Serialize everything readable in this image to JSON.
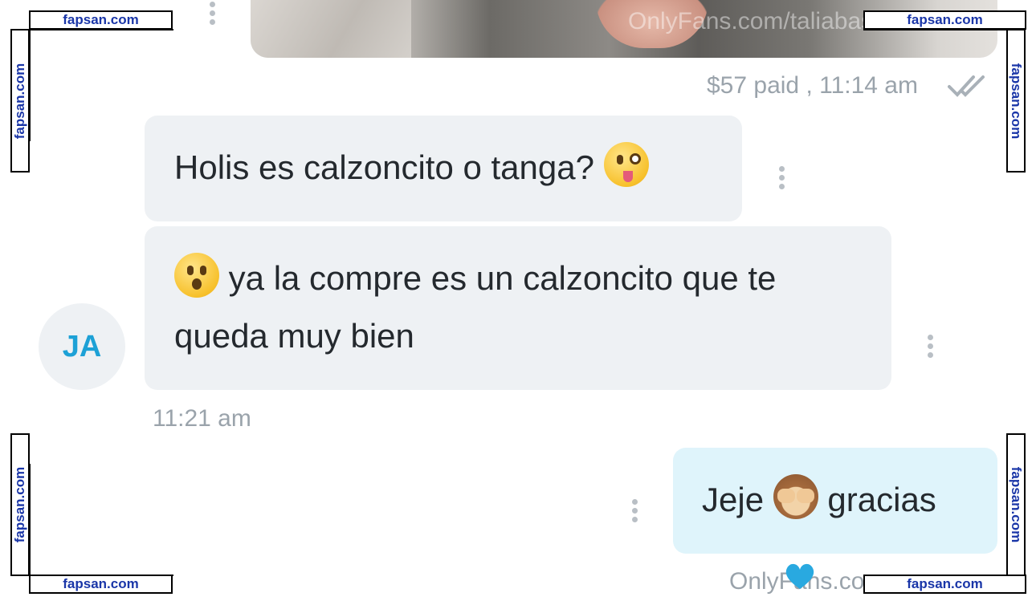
{
  "media": {
    "watermark": "OnlyFans.com/taliabasurtt"
  },
  "paid_status": {
    "text": "$57 paid , 11:14 am"
  },
  "incoming": {
    "avatar_initials": "JA",
    "message1": "Holis es calzoncito o tanga?",
    "message2_line1": "ya la compre es un calzoncito que te",
    "message2_line2": "queda muy bien",
    "time": "11:21 am"
  },
  "outgoing": {
    "part1": "Jeje",
    "part2": "gracias",
    "bottom_text": "OnlyFans.com"
  },
  "icons": [
    "more-vertical-icon",
    "double-check-icon",
    "heart-icon",
    "winking-tongue-emoji",
    "surprised-face-emoji",
    "see-no-evil-monkey-emoji"
  ],
  "watermarks": {
    "top_left": "fapsan.com",
    "top_right": "fapsan.com",
    "bottom_left": "fapsan.com",
    "bottom_right": "fapsan.com",
    "left_upper": "fapsan.com",
    "right_upper": "fapsan.com",
    "left_lower": "fapsan.com",
    "right_lower": "fapsan.com"
  },
  "colors": {
    "accent": "#1da1d6",
    "incoming_bubble": "#eef1f4",
    "outgoing_bubble": "#dff4fb",
    "meta_text": "#9aa3ab",
    "watermark": "#1a36a8"
  }
}
